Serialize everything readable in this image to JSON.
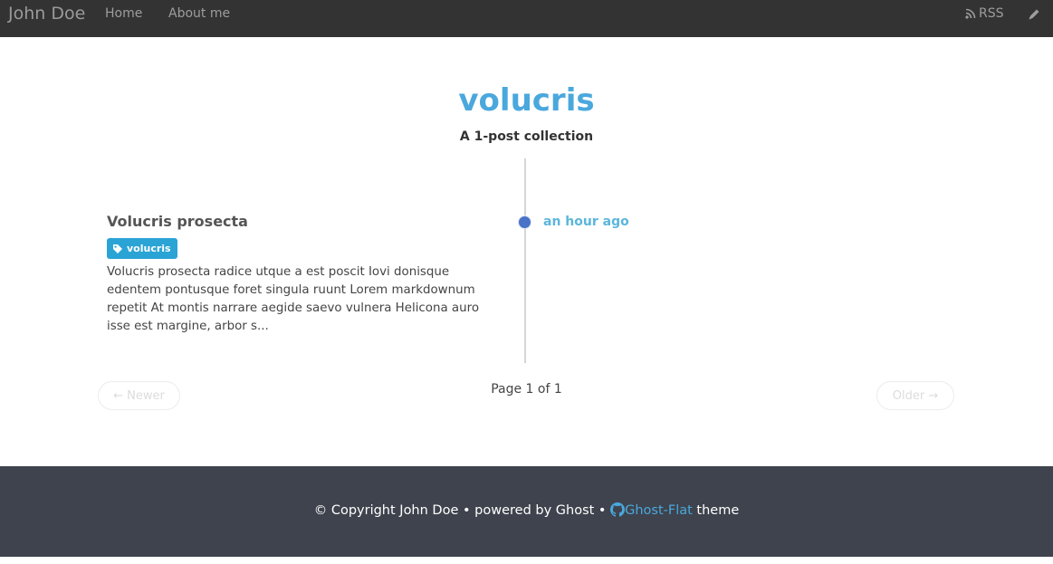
{
  "navbar": {
    "brand": "John Doe",
    "links": [
      {
        "label": "Home"
      },
      {
        "label": "About me"
      }
    ],
    "rss_label": "RSS",
    "rss_icon": "rss-icon",
    "edit_icon": "pencil-icon"
  },
  "header": {
    "title": "volucris",
    "subtitle": "A 1-post collection"
  },
  "posts": [
    {
      "title": "Volucris prosecta",
      "tag": "volucris",
      "tag_icon": "tag-icon",
      "excerpt": "Volucris prosecta radice utque a est poscit Iovi donisque edentem pontusque foret singula ruunt Lorem markdownum repetit At montis narrare aegide saevo vulnera Helicona auro isse est margine, arbor s...",
      "date": "an hour ago"
    }
  ],
  "pagination": {
    "newer_label": "← Newer",
    "older_label": "Older →",
    "page_text": "Page 1 of 1"
  },
  "footer": {
    "copyright": "© Copyright John Doe • powered by Ghost • ",
    "theme_link": "Ghost-Flat",
    "theme_suffix": " theme",
    "github_icon": "github-icon"
  },
  "colors": {
    "navbar_bg": "#333333",
    "accent": "#4aa8dd",
    "tag_bg": "#2aa4d5",
    "timeline_dot": "#4a72c7",
    "footer_bg": "#3e434d"
  }
}
